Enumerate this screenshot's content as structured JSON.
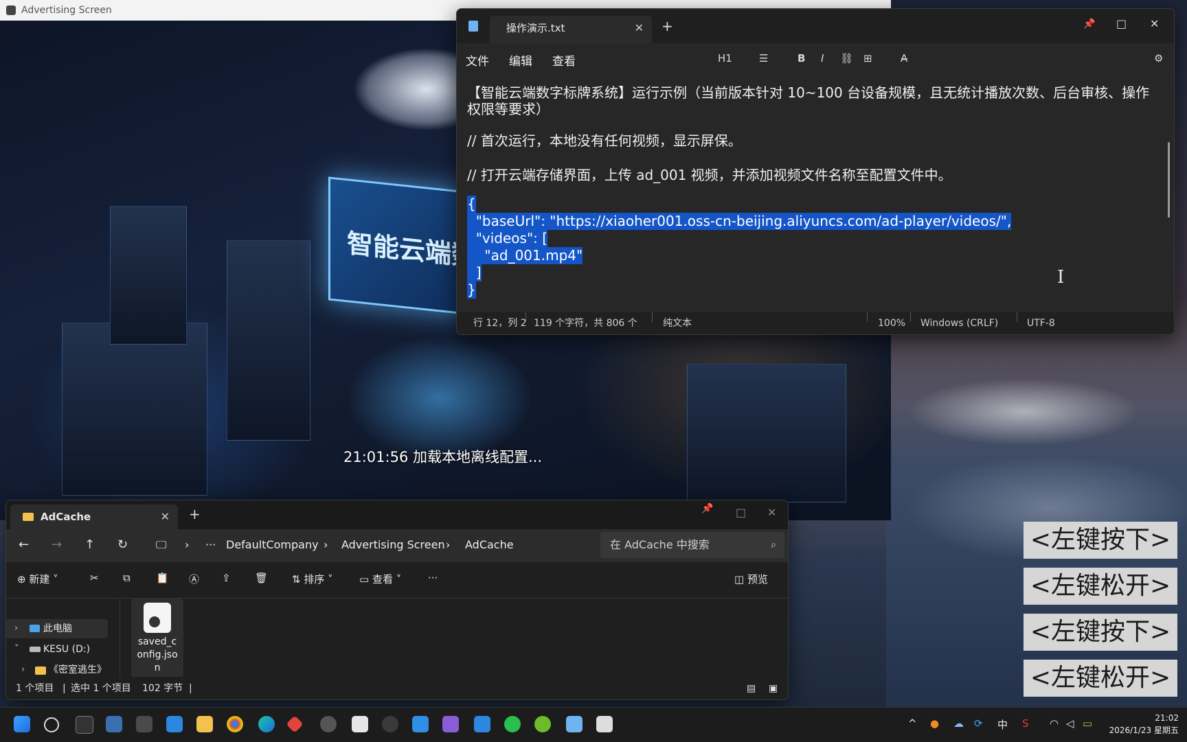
{
  "ad_window": {
    "title": "Advertising Screen",
    "billboard_text": "智能云端数字",
    "status_text": "21:01:56 加载本地离线配置..."
  },
  "notepad": {
    "tab_title": "操作演示.txt",
    "tab_close": "✕",
    "new_tab": "+",
    "menu": {
      "file": "文件",
      "edit": "编辑",
      "view": "查看"
    },
    "toolbar": {
      "heading": "H1",
      "list": "☰",
      "bold": "B",
      "italic": "I",
      "link": "⛓",
      "table": "⊞",
      "clear": "A̶",
      "settings": "⚙"
    },
    "lines": [
      "【智能云端数字标牌系统】运行示例（当前版本针对 10~100 台设备规模，且无统计播放次数、后台审核、操作",
      "权限等要求）",
      "// 首次运行，本地没有任何视频，显示屏保。",
      "// 打开云端存储界面，上传 ad_001 视频，并添加视频文件名称至配置文件中。",
      "{",
      "  \"baseUrl\": \"https://xiaoher001.oss-cn-beijing.aliyuncs.com/ad-player/videos/\",",
      "  \"videos\": [",
      "    \"ad_001.mp4\"",
      "  ]",
      "}"
    ],
    "status": {
      "position": "行 12，列 2",
      "chars": "119 个字符，共 806 个",
      "format": "纯文本",
      "zoom": "100%",
      "line_ending": "Windows (CRLF)",
      "encoding": "UTF-8"
    }
  },
  "explorer": {
    "tab_title": "AdCache",
    "tab_close": "✕",
    "new_tab": "+",
    "breadcrumb": [
      "DefaultCompany",
      "Advertising Screen",
      "AdCache"
    ],
    "search_placeholder": "在 AdCache 中搜索",
    "commands": {
      "new": "新建",
      "sort": "排序",
      "view": "查看",
      "more": "···",
      "preview": "预览"
    },
    "nav": [
      {
        "label": "此电脑"
      },
      {
        "label": "KESU (D:)"
      },
      {
        "label": "《密室逃生》"
      }
    ],
    "file": {
      "name": "saved_config.json",
      "name_lines": [
        "saved_c",
        "onfig.jso",
        "n"
      ]
    },
    "status": {
      "items": "1 个项目",
      "selected": "选中 1 个项目",
      "size": "102 字节"
    }
  },
  "key_overlay": [
    "<左键按下>",
    "<左键松开>",
    "<左键按下>",
    "<左键松开>"
  ],
  "taskbar": {
    "ime": "中",
    "time": "21:02",
    "date": "2026/1/23 星期五"
  }
}
